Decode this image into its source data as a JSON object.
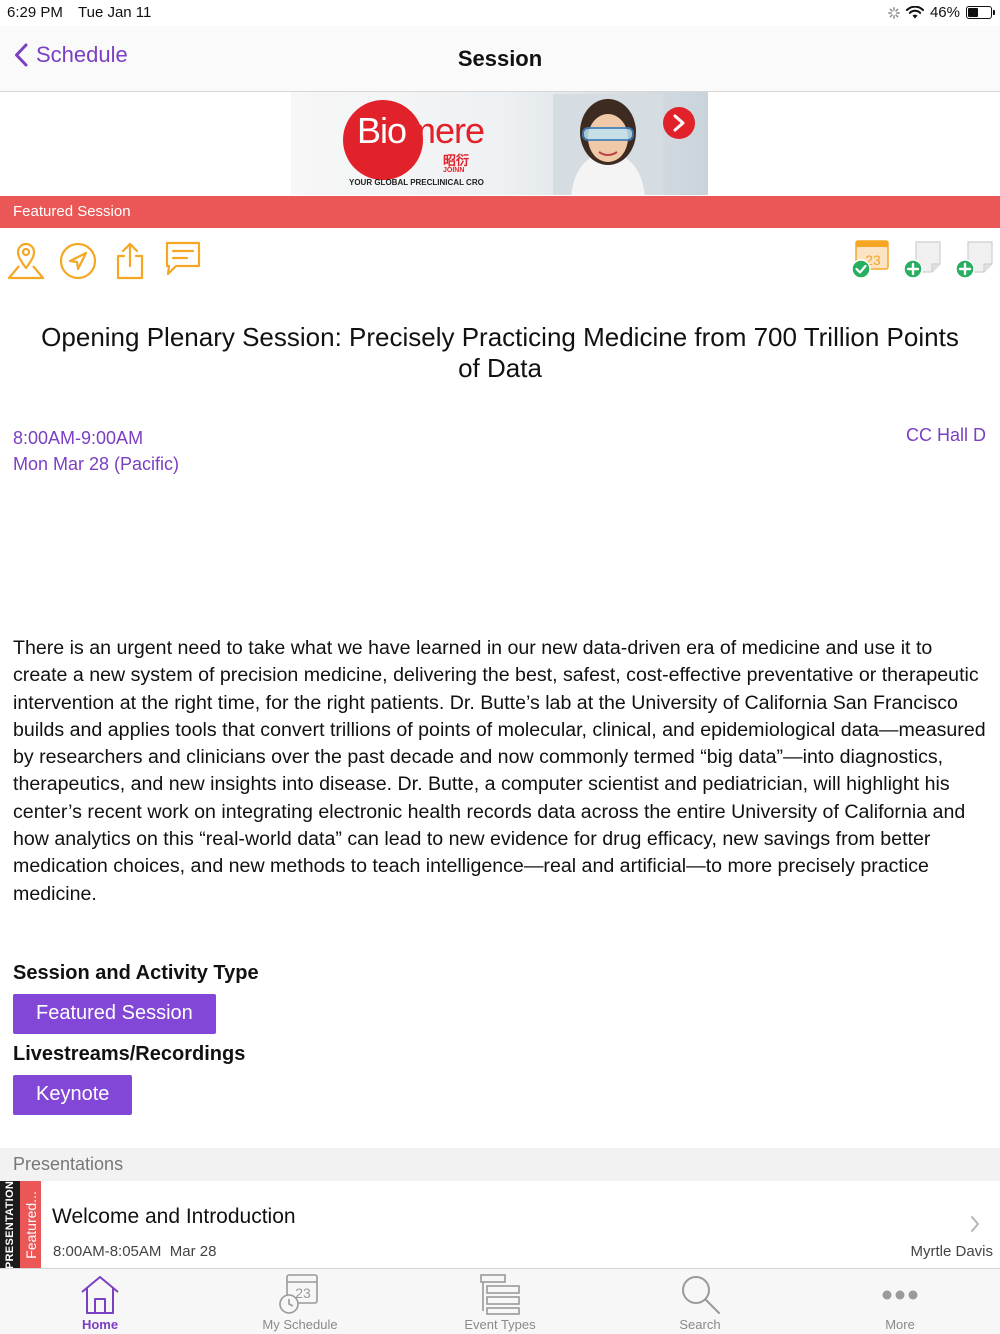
{
  "status_bar": {
    "time": "6:29 PM",
    "date": "Tue Jan 11",
    "battery": "46%",
    "battery_level": 0.46
  },
  "nav": {
    "back_label": "Schedule",
    "title": "Session"
  },
  "banner": {
    "brand_prefix": "Bio",
    "brand_suffix": "mere",
    "cn_text": "昭衍",
    "sub_text": "JOINN",
    "tagline": "YOUR GLOBAL PRECLINICAL CRO"
  },
  "featured_label": "Featured Session",
  "calendar_icon_day": "23",
  "session": {
    "title": "Opening Plenary Session: Precisely Practicing Medicine from 700 Trillion Points of Data",
    "time": "8:00AM-9:00AM",
    "date": "Mon Mar 28 (Pacific)",
    "room": "CC Hall D",
    "description": "There is an urgent need to take what we have learned in our new data-driven era of medicine and use it to create a new system of precision medicine, delivering the best, safest, cost-effective preventative or therapeutic intervention at the right time, for the right patients. Dr. Butte’s lab at the University of California San Francisco builds and applies tools that convert trillions of points of molecular, clinical, and epidemiological data—measured by researchers and clinicians over the past decade and now commonly termed “big data”—into diagnostics, therapeutics, and new insights into disease. Dr. Butte, a computer scientist and pediatrician, will highlight his center’s recent work on integrating electronic health records data across the entire University of California and how analytics on this “real-world data” can lead to new evidence for drug efficacy, new savings from better medication choices, and new methods to teach intelligence—real and artificial—to more precisely practice medicine."
  },
  "activity_type": {
    "heading": "Session and Activity Type",
    "tag": "Featured Session"
  },
  "livestreams": {
    "heading": "Livestreams/Recordings",
    "tag": "Keynote"
  },
  "presentations": {
    "header": "Presentations",
    "items": [
      {
        "type_label": "PRESENTATION",
        "category_label": "Featured...",
        "title": "Welcome and Introduction",
        "time": "8:00AM-8:05AM",
        "date": "Mar 28",
        "speaker": "Myrtle Davis"
      }
    ]
  },
  "tabs": [
    {
      "label": "Home",
      "icon": "home-icon",
      "active": true
    },
    {
      "label": "My Schedule",
      "icon": "calendar-clock-icon",
      "active": false
    },
    {
      "label": "Event Types",
      "icon": "list-icon",
      "active": false
    },
    {
      "label": "Search",
      "icon": "search-icon",
      "active": false
    },
    {
      "label": "More",
      "icon": "more-icon",
      "active": false
    }
  ],
  "colors": {
    "accent": "#7b3fc4",
    "featured_red": "#eb5757",
    "tag_purple": "#8247d6",
    "icon_orange": "#f5a623",
    "success_green": "#27ae60"
  }
}
